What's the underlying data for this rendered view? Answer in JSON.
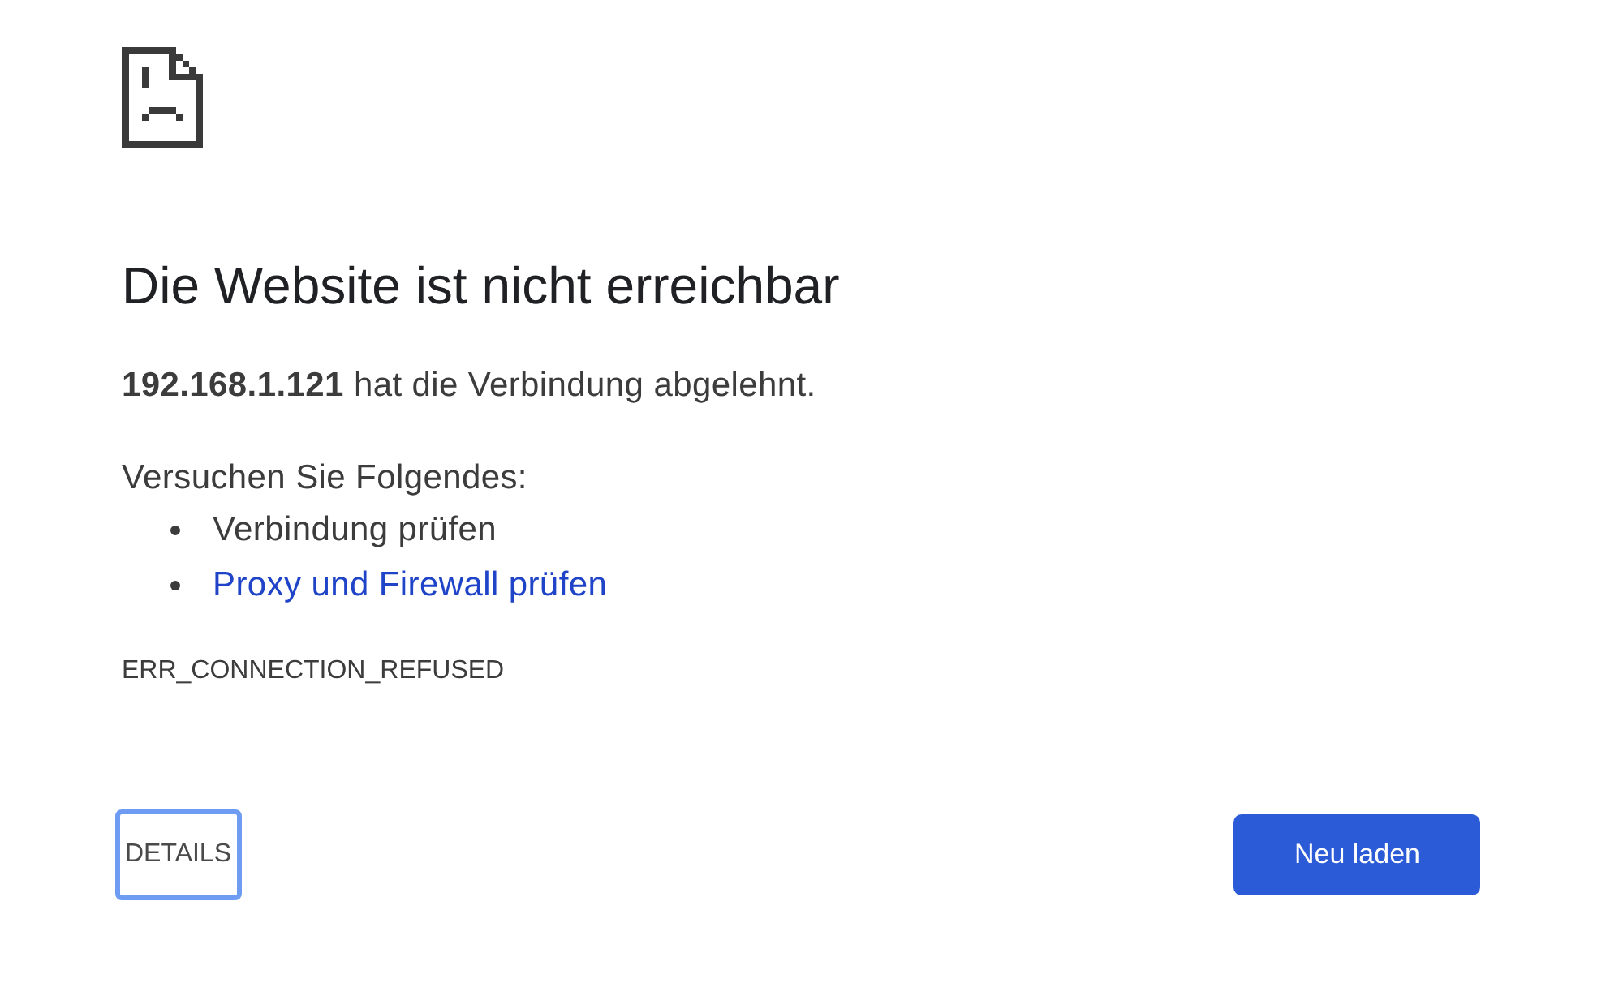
{
  "heading": "Die Website ist nicht erreichbar",
  "message": "**192.168.1.121** hat die Verbindung abgelehnt.",
  "suggestions": {
    "intro": "Versuchen Sie Folgendes:",
    "items": [
      {
        "kind": "text",
        "text": "Verbindung prüfen"
      },
      {
        "kind": "link",
        "text": "Proxy und Firewall prüfen"
      }
    ]
  },
  "error_code": "ERR_CONNECTION_REFUSED",
  "buttons": [
    {
      "kind": "secondary",
      "label": "DETAILS",
      "focused": true
    },
    {
      "kind": "primary",
      "label": "Neu laden"
    }
  ]
}
